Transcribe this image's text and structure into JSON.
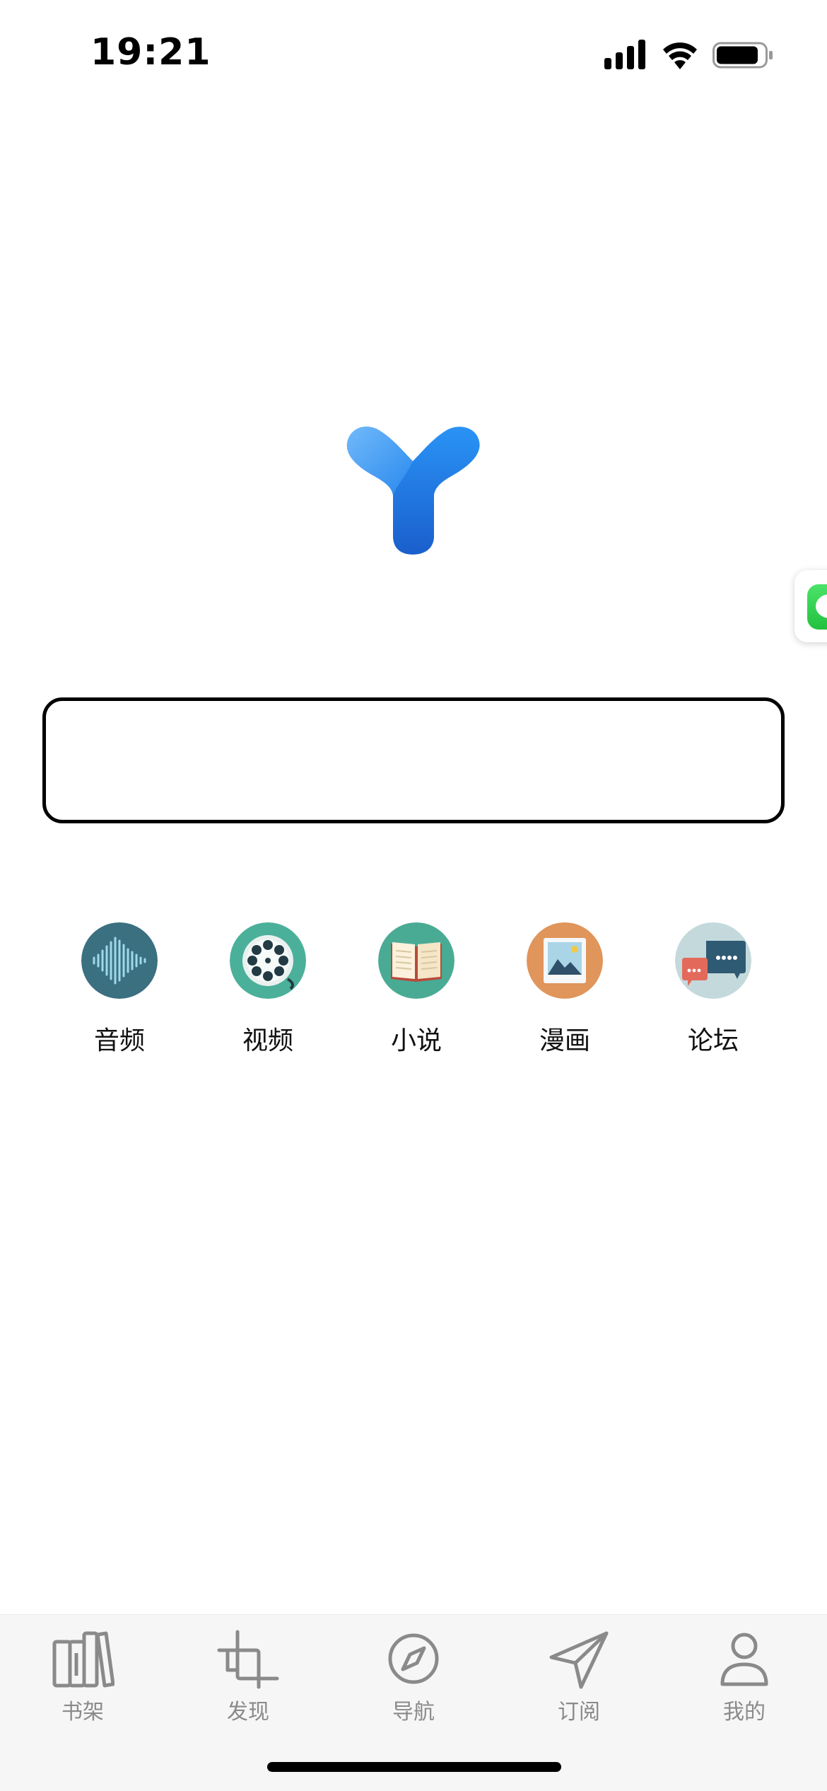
{
  "status_bar": {
    "time": "19:21"
  },
  "search": {
    "value": "",
    "placeholder": ""
  },
  "categories": [
    {
      "label": "音频",
      "icon": "audio-wave-icon",
      "color": "#3b7080"
    },
    {
      "label": "视频",
      "icon": "film-reel-icon",
      "color": "#4bb09a"
    },
    {
      "label": "小说",
      "icon": "open-book-icon",
      "color": "#4aab95"
    },
    {
      "label": "漫画",
      "icon": "picture-icon",
      "color": "#e0955a"
    },
    {
      "label": "论坛",
      "icon": "chat-bubbles-icon",
      "color": "#c4d9dc"
    }
  ],
  "tab_bar": [
    {
      "label": "书架",
      "icon": "bookshelf-icon"
    },
    {
      "label": "发现",
      "icon": "crop-frame-icon"
    },
    {
      "label": "导航",
      "icon": "compass-icon"
    },
    {
      "label": "订阅",
      "icon": "paper-plane-icon"
    },
    {
      "label": "我的",
      "icon": "person-icon"
    }
  ],
  "colors": {
    "logo_blue": "#1e7ee6",
    "tab_icon": "#8a8a8a",
    "side_chat_green": "#2bd04b"
  }
}
